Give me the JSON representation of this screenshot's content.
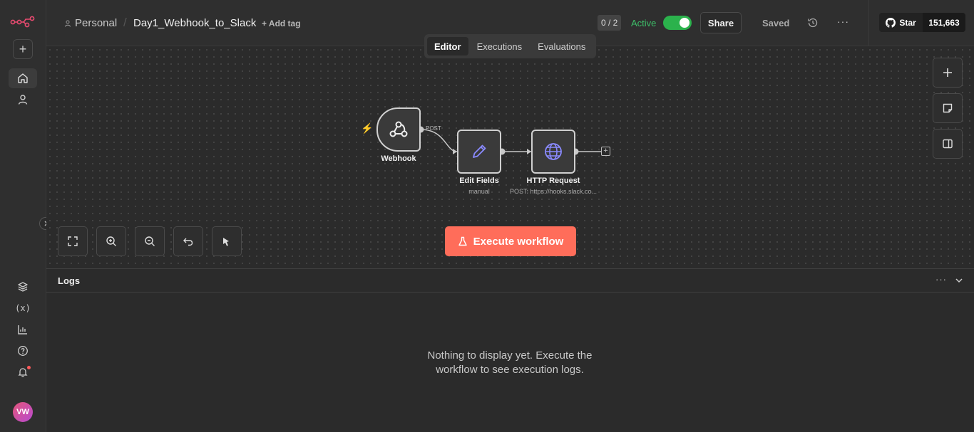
{
  "breadcrumb": {
    "owner": "Personal",
    "workflow_name": "Day1_Webhook_to_Slack",
    "add_tag": "+ Add tag"
  },
  "header": {
    "counter": "0 / 2",
    "active_label": "Active",
    "active": true,
    "share_label": "Share",
    "saved_label": "Saved"
  },
  "github": {
    "star_label": "Star",
    "star_count": "151,663"
  },
  "tabs": [
    {
      "label": "Editor",
      "active": true
    },
    {
      "label": "Executions",
      "active": false
    },
    {
      "label": "Evaluations",
      "active": false
    }
  ],
  "nodes": {
    "webhook": {
      "label": "Webhook",
      "output_label": "POST",
      "icon": "webhook-icon"
    },
    "edit_fields": {
      "label": "Edit Fields",
      "subtitle": "manual",
      "icon": "pencil-icon"
    },
    "http_request": {
      "label": "HTTP Request",
      "subtitle": "POST: https://hooks.slack.co...",
      "icon": "globe-icon"
    }
  },
  "execute_button": "Execute workflow",
  "logs": {
    "title": "Logs",
    "empty_message": "Nothing to display yet. Execute the workflow to see execution logs."
  },
  "avatar_initials": "VW",
  "colors": {
    "accent": "#ff6d5a",
    "active_green": "#2bb24c",
    "node_accent": "#7b7bff"
  }
}
